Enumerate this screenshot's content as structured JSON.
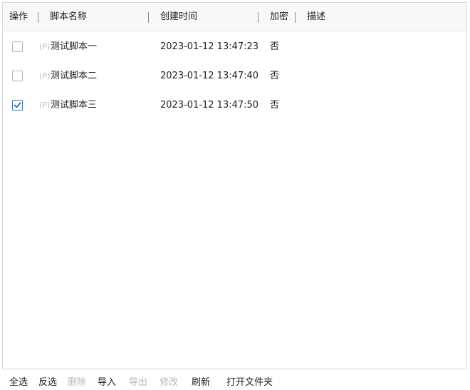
{
  "table": {
    "headers": {
      "action": "操作",
      "name": "脚本名称",
      "created": "创建时间",
      "encrypted": "加密",
      "description": "描述"
    },
    "rows": [
      {
        "checked": false,
        "prefix": "(P)",
        "name": "测试脚本一",
        "created": "2023-01-12 13:47:23",
        "encrypted": "否",
        "description": ""
      },
      {
        "checked": false,
        "prefix": "(P)",
        "name": "测试脚本二",
        "created": "2023-01-12 13:47:40",
        "encrypted": "否",
        "description": ""
      },
      {
        "checked": true,
        "prefix": "(P)",
        "name": "测试脚本三",
        "created": "2023-01-12 13:47:50",
        "encrypted": "否",
        "description": ""
      }
    ]
  },
  "toolbar": {
    "select_all": "全选",
    "invert": "反选",
    "delete": "删除",
    "import": "导入",
    "export": "导出",
    "edit": "修改",
    "refresh": "刷新",
    "open_folder": "打开文件夹"
  },
  "colors": {
    "accent": "#3a6fb0",
    "disabled_text": "#b8b8b8"
  }
}
